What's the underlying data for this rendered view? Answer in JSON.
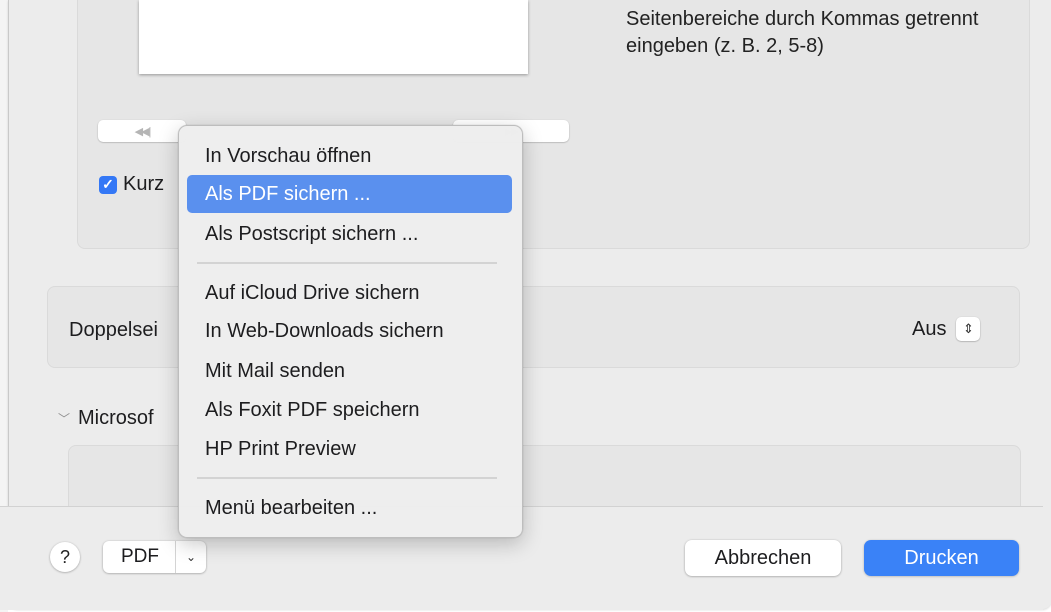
{
  "preview": {
    "hint_text": "Seitenbereiche durch Kommas getrennt eingeben (z. B. 2, 5-8)",
    "prev_icon": "rewind-icon",
    "next_icon": "fast-forward-icon",
    "prev_glyph": "◀◀ |",
    "next_glyph": "▶▶",
    "checkbox_label": "Kurz",
    "checkbox_checked": true
  },
  "duplex": {
    "label": "Doppelsei",
    "value": "Aus"
  },
  "microsoft": {
    "label": "Microsof"
  },
  "footer": {
    "help_label": "?",
    "pdf_label": "PDF",
    "cancel_label": "Abbrechen",
    "print_label": "Drucken"
  },
  "pdf_menu": {
    "items": [
      {
        "label": "In Vorschau öffnen",
        "selected": false
      },
      {
        "label": "Als PDF sichern ...",
        "selected": true
      },
      {
        "label": "Als Postscript sichern ...",
        "selected": false
      },
      {
        "label": "Auf iCloud Drive sichern",
        "selected": false
      },
      {
        "label": "In Web-Downloads sichern",
        "selected": false
      },
      {
        "label": "Mit Mail senden",
        "selected": false
      },
      {
        "label": "Als Foxit PDF speichern",
        "selected": false
      },
      {
        "label": "HP Print Preview",
        "selected": false
      },
      {
        "label": "Menü bearbeiten ...",
        "selected": false
      }
    ]
  },
  "colors": {
    "accent": "#3a82f7",
    "menu_highlight": "#5a90ee",
    "dialog_bg": "#ececec"
  }
}
